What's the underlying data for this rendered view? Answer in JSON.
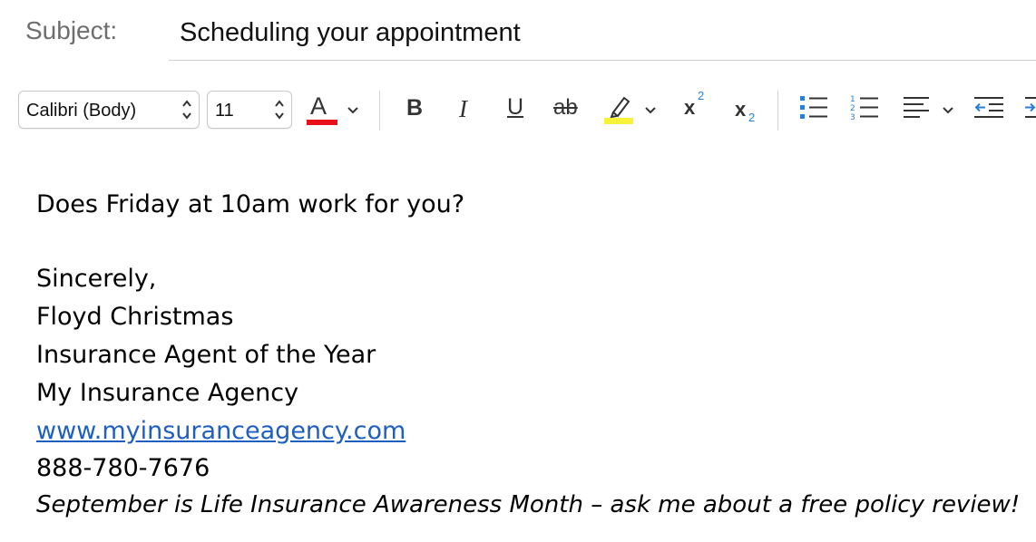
{
  "subject": {
    "label": "Subject:",
    "value": "Scheduling your appointment"
  },
  "toolbar": {
    "font_family": "Calibri (Body)",
    "font_size": "11",
    "font_color_letter": "A",
    "font_color": "#e8111b",
    "bold": "B",
    "italic": "I",
    "underline": "U",
    "strikethrough": "ab",
    "highlight_color": "#f7f13a",
    "superscript_base": "x",
    "superscript_exp": "2",
    "subscript_base": "x",
    "subscript_exp": "2",
    "icons": [
      "font-color-icon",
      "bold-icon",
      "italic-icon",
      "underline-icon",
      "strikethrough-icon",
      "highlight-icon",
      "superscript-icon",
      "subscript-icon",
      "bulleted-list-icon",
      "numbered-list-icon",
      "align-icon",
      "decrease-indent-icon",
      "increase-indent-icon"
    ]
  },
  "body": {
    "question": "Does Friday at 10am work for you?",
    "signoff": "Sincerely,",
    "name": "Floyd Christmas",
    "title": "Insurance Agent of the Year",
    "company": "My Insurance Agency",
    "website": "www.myinsuranceagency.com",
    "phone": "888-780-7676",
    "tagline": "September is Life Insurance Awareness Month – ask me about a free policy review!"
  },
  "colors": {
    "link": "#1f5fbf",
    "accent_blue": "#2a7fd4"
  }
}
